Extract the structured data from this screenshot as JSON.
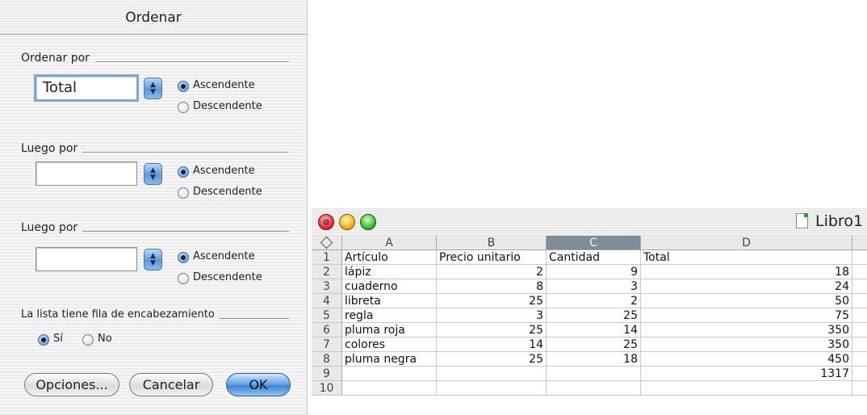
{
  "dialog": {
    "title": "Ordenar",
    "sort_by": {
      "label": "Ordenar por",
      "field_value": "Total",
      "ascending": "Ascendente",
      "descending": "Descendente",
      "selected": "ascending"
    },
    "then_by_1": {
      "label": "Luego por",
      "field_value": "",
      "ascending": "Ascendente",
      "descending": "Descendente",
      "selected": "ascending"
    },
    "then_by_2": {
      "label": "Luego por",
      "field_value": "",
      "ascending": "Ascendente",
      "descending": "Descendente",
      "selected": "ascending"
    },
    "header_row": {
      "label": "La lista tiene fila de encabezamiento",
      "yes": "Sí",
      "no": "No",
      "selected": "yes"
    },
    "buttons": {
      "options": "Opciones...",
      "cancel": "Cancelar",
      "ok": "OK"
    }
  },
  "sheet": {
    "window_title": "Libro1",
    "columns": [
      "A",
      "B",
      "C",
      "D"
    ],
    "selected_column": "C",
    "rows": [
      {
        "n": "1",
        "a": "Artículo",
        "b": "Precio unitario",
        "c": "Cantidad",
        "d": "Total"
      },
      {
        "n": "2",
        "a": "lápiz",
        "b": "2",
        "c": "9",
        "d": "18"
      },
      {
        "n": "3",
        "a": "cuaderno",
        "b": "8",
        "c": "3",
        "d": "24"
      },
      {
        "n": "4",
        "a": "libreta",
        "b": "25",
        "c": "2",
        "d": "50"
      },
      {
        "n": "5",
        "a": "regla",
        "b": "3",
        "c": "25",
        "d": "75"
      },
      {
        "n": "6",
        "a": "pluma roja",
        "b": "25",
        "c": "14",
        "d": "350"
      },
      {
        "n": "7",
        "a": "colores",
        "b": "14",
        "c": "25",
        "d": "350"
      },
      {
        "n": "8",
        "a": "pluma negra",
        "b": "25",
        "c": "18",
        "d": "450"
      },
      {
        "n": "9",
        "a": "",
        "b": "",
        "c": "",
        "d": "1317"
      },
      {
        "n": "10",
        "a": "",
        "b": "",
        "c": "",
        "d": ""
      }
    ]
  }
}
